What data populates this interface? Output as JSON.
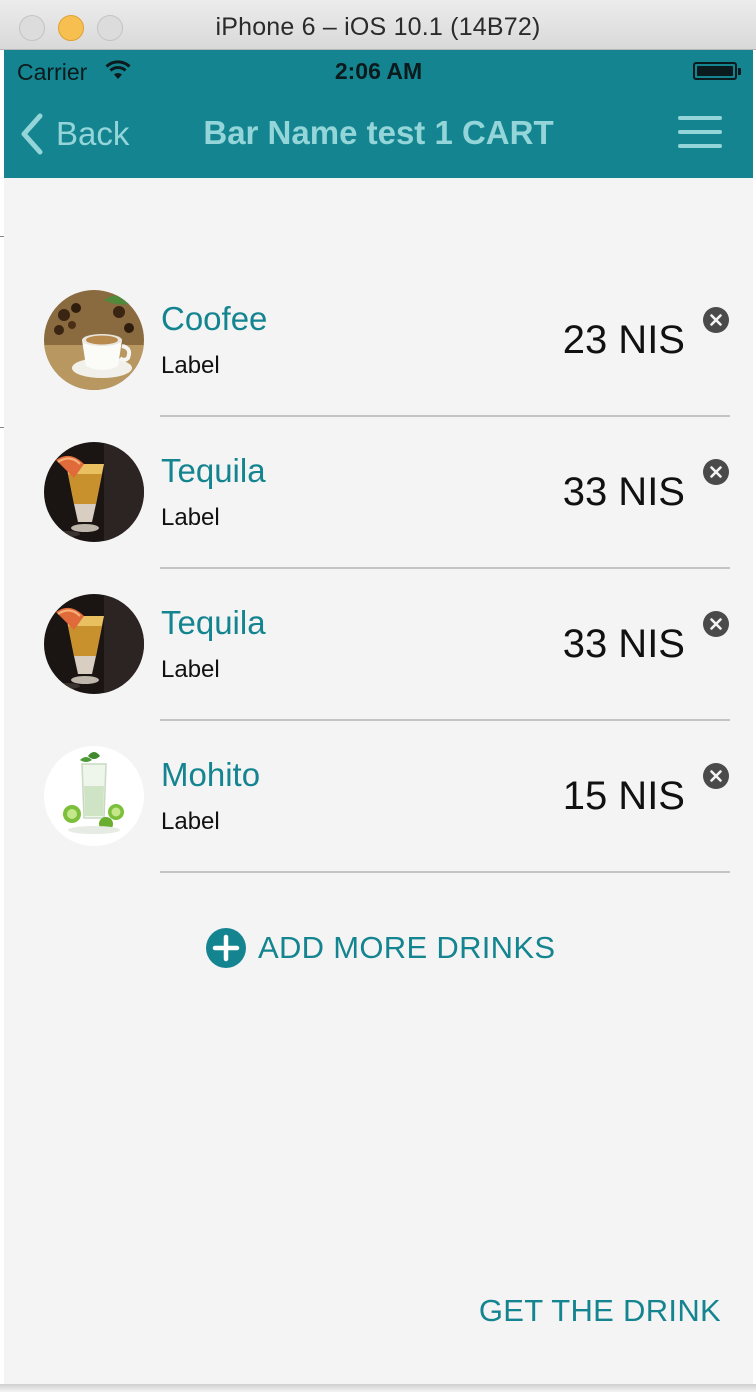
{
  "window": {
    "title": "iPhone 6 – iOS 10.1 (14B72)"
  },
  "status_bar": {
    "carrier": "Carrier",
    "time": "2:06 AM"
  },
  "nav": {
    "back_label": "Back",
    "title": "Bar Name test 1 CART"
  },
  "cart": {
    "items": [
      {
        "name": "Coofee",
        "subtitle": "Label",
        "price": "23 NIS",
        "image": "coffee-photo"
      },
      {
        "name": "Tequila",
        "subtitle": "Label",
        "price": "33 NIS",
        "image": "tequila-photo"
      },
      {
        "name": "Tequila",
        "subtitle": "Label",
        "price": "33 NIS",
        "image": "tequila-photo"
      },
      {
        "name": "Mohito",
        "subtitle": "Label",
        "price": "15 NIS",
        "image": "mojito-photo"
      }
    ]
  },
  "actions": {
    "add_more_label": "ADD MORE DRINKS",
    "get_drink_label": "GET THE DRINK"
  },
  "colors": {
    "brand_teal": "#148590",
    "nav_text": "#93d5d8",
    "background": "#f4f4f4"
  }
}
